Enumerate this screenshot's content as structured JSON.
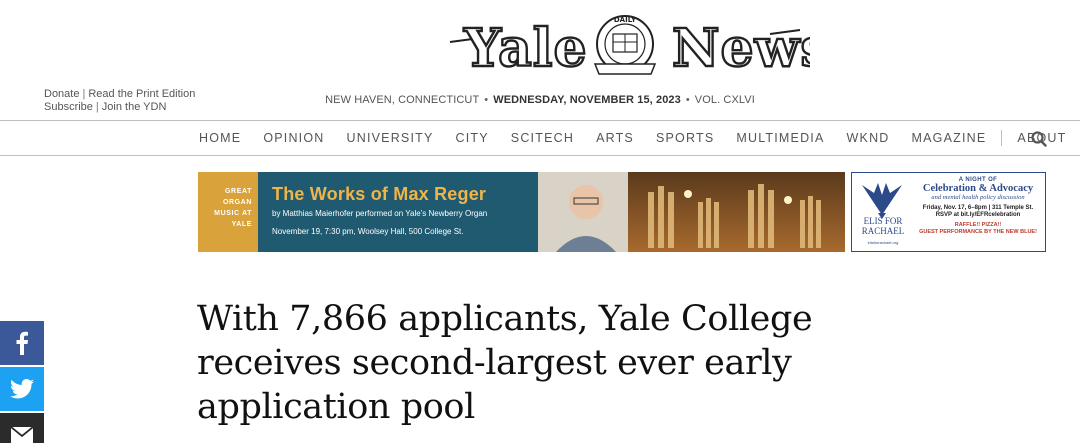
{
  "masthead": {
    "left_word": "Yale",
    "right_word": "News",
    "seal_text": "DAILY"
  },
  "top_links": {
    "row1": [
      "Donate",
      "Read the Print Edition"
    ],
    "row2": [
      "Subscribe",
      "Join the YDN"
    ]
  },
  "dateline": {
    "location": "NEW HAVEN, CONNECTICUT",
    "date": "WEDNESDAY, NOVEMBER 15, 2023",
    "volume": "VOL. CXLVI"
  },
  "nav": {
    "items": [
      "HOME",
      "OPINION",
      "UNIVERSITY",
      "CITY",
      "SCITECH",
      "ARTS",
      "SPORTS",
      "MULTIMEDIA",
      "WKND",
      "MAGAZINE"
    ],
    "about": "ABOUT",
    "search_icon": "search-icon"
  },
  "ad_main": {
    "kicker_lines": [
      "GREAT",
      "ORGAN",
      "MUSIC AT",
      "YALE"
    ],
    "title": "The Works of Max Reger",
    "subtitle": "by Matthias Maierhofer performed on Yale’s Newberry Organ",
    "date": "November 19, 7:30 pm, Woolsey Hall, 500 College St.",
    "colors": {
      "gold": "#d9a23a",
      "teal": "#1f5a70",
      "title": "#f0b54a"
    }
  },
  "ad_side": {
    "brand": [
      "ELIS FOR",
      "RACHAEL"
    ],
    "url": "elisforrachael.org",
    "kicker": "A NIGHT OF",
    "title": "Celebration & Advocacy",
    "tagline": "and mental health policy discussion",
    "info_line1": "Friday, Nov. 17, 6–8pm  |  311 Temple St.",
    "info_line2": "RSVP at bit.ly/EFRcelebration",
    "raffle_line1": "RAFFLE!!  PIZZA!!",
    "raffle_line2": "GUEST PERFORMANCE BY THE NEW BLUE!",
    "color": "#2c4a8a"
  },
  "article": {
    "headline": "With 7,866 applicants, Yale College receives second-largest ever early application pool"
  },
  "share": {
    "facebook_icon": "facebook-icon",
    "twitter_icon": "twitter-icon",
    "email_icon": "email-icon",
    "colors": {
      "facebook": "#3b5998",
      "twitter": "#1da1f2",
      "email": "#2b2b2b"
    }
  }
}
